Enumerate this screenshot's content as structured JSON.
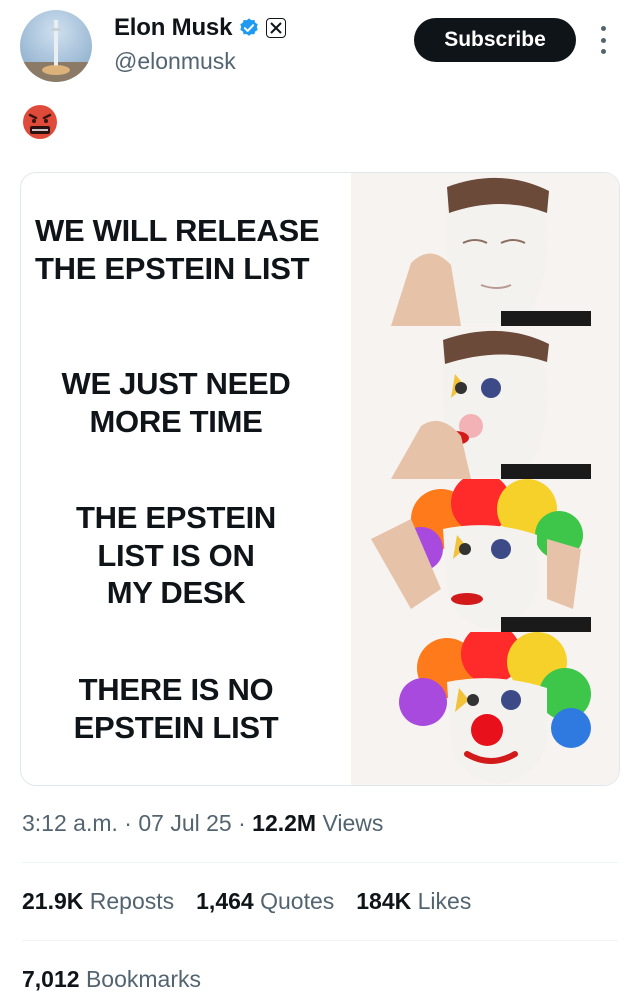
{
  "author": {
    "name": "Elon Musk",
    "handle": "@elonmusk",
    "verified_color": "#1d9bf0",
    "affiliate_badge": "X"
  },
  "subscribe_label": "Subscribe",
  "post": {
    "emoji": "angry-face-with-symbols-emoji"
  },
  "meme": {
    "panels": [
      {
        "caption": "WE WILL RELEASE\nTHE EPSTEIN LIST",
        "image": "man-applying-white-face-paint"
      },
      {
        "caption": "WE JUST NEED\nMORE TIME",
        "image": "man-applying-clown-makeup"
      },
      {
        "caption": "THE EPSTEIN\nLIST IS ON\nMY DESK",
        "image": "man-putting-on-rainbow-clown-wig"
      },
      {
        "caption": "THERE IS NO\nEPSTEIN LIST",
        "image": "full-clown-with-red-nose"
      }
    ]
  },
  "meta": {
    "time": "3:12 a.m.",
    "sep1": " · ",
    "date": "07 Jul 25",
    "sep2": " · ",
    "views_count": "12.2M",
    "views_label": " Views"
  },
  "engagement": {
    "reposts_count": "21.9K",
    "reposts_label": " Reposts",
    "quotes_count": "1,464",
    "quotes_label": " Quotes",
    "likes_count": "184K",
    "likes_label": " Likes",
    "bookmarks_count": "7,012",
    "bookmarks_label": " Bookmarks"
  }
}
